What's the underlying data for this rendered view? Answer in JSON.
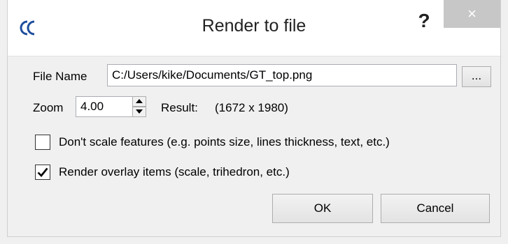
{
  "window": {
    "title": "Render to file",
    "app_icon": "cloudcompare-logo-icon",
    "help_label": "?",
    "close_label": "×"
  },
  "file_name": {
    "label": "File Name",
    "value": "C:/Users/kike/Documents/GT_top.png",
    "browse_label": "..."
  },
  "zoom": {
    "label": "Zoom",
    "value": "4.00",
    "result_label": "Result:",
    "result_value": "(1672 x 1980)"
  },
  "options": [
    {
      "label": "Don't scale features (e.g. points size, lines thickness, text, etc.)",
      "checked": false
    },
    {
      "label": "Render overlay items (scale, trihedron, etc.)",
      "checked": true
    }
  ],
  "buttons": {
    "ok": "OK",
    "cancel": "Cancel"
  },
  "colors": {
    "title_bar": "#ffffff",
    "dialog_bg": "#f0f0f0",
    "close_button": "#c7c7c7",
    "app_icon": "#1f4e9e"
  }
}
